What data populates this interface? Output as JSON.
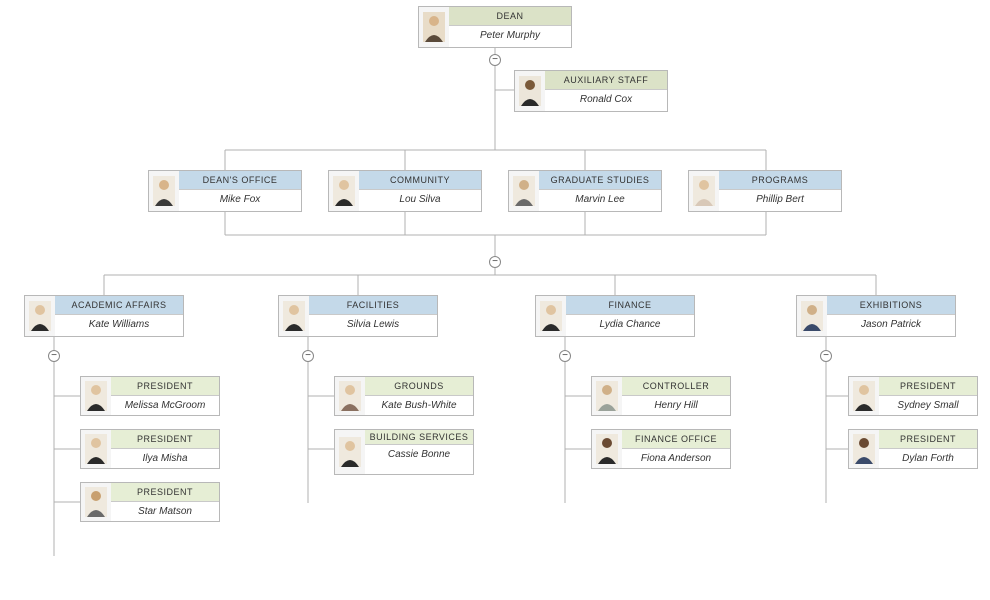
{
  "nodes": {
    "dean": {
      "title": "DEAN",
      "name": "Peter Murphy",
      "color": "olive"
    },
    "aux": {
      "title": "AUXILIARY STAFF",
      "name": "Ronald Cox",
      "color": "olive"
    },
    "deans_office": {
      "title": "DEAN'S OFFICE",
      "name": "Mike Fox",
      "color": "blue"
    },
    "community": {
      "title": "COMMUNITY",
      "name": "Lou Silva",
      "color": "blue"
    },
    "grad": {
      "title": "GRADUATE STUDIES",
      "name": "Marvin Lee",
      "color": "blue"
    },
    "programs": {
      "title": "PROGRAMS",
      "name": "Phillip Bert",
      "color": "blue"
    },
    "academic": {
      "title": "ACADEMIC AFFAIRS",
      "name": "Kate Williams",
      "color": "blue"
    },
    "facilities": {
      "title": "FACILITIES",
      "name": "Silvia Lewis",
      "color": "blue"
    },
    "finance": {
      "title": "FINANCE",
      "name": "Lydia Chance",
      "color": "blue"
    },
    "exhibitions": {
      "title": "EXHIBITIONS",
      "name": "Jason Patrick",
      "color": "blue"
    },
    "president1": {
      "title": "PRESIDENT",
      "name": "Melissa McGroom",
      "color": "green"
    },
    "president2": {
      "title": "PRESIDENT",
      "name": "Ilya Misha",
      "color": "green"
    },
    "president3": {
      "title": "PRESIDENT",
      "name": "Star Matson",
      "color": "green"
    },
    "grounds": {
      "title": "GROUNDS",
      "name": "Kate Bush-White",
      "color": "green"
    },
    "building": {
      "title": "BUILDING SERVICES",
      "name": "Cassie Bonne",
      "color": "green"
    },
    "controller": {
      "title": "CONTROLLER",
      "name": "Henry Hill",
      "color": "green"
    },
    "finance_office": {
      "title": "FINANCE OFFICE",
      "name": "Fiona Anderson",
      "color": "green"
    },
    "exh_president1": {
      "title": "PRESIDENT",
      "name": "Sydney Small",
      "color": "green"
    },
    "exh_president2": {
      "title": "PRESIDENT",
      "name": "Dylan Forth",
      "color": "green"
    }
  },
  "toggle_glyph": "−"
}
